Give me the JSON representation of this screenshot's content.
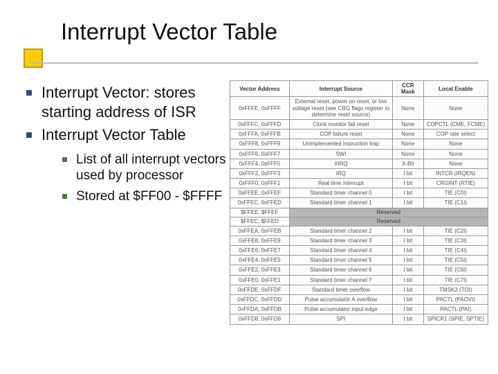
{
  "title": "Interrupt Vector Table",
  "bullets": {
    "b1": "Interrupt Vector: stores starting address of ISR",
    "b2": "Interrupt Vector Table",
    "b2a": "List of all interrupt vectors used by processor",
    "b2b": "Stored at $FF00 - $FFFF"
  },
  "table": {
    "headers": {
      "addr": "Vector Address",
      "src": "Interrupt Source",
      "mask": "CCR Mask",
      "en": "Local Enable"
    },
    "rows": [
      {
        "addr": "0xFFFE, 0xFFFF",
        "src": "External reset, power on reset, or low voltage reset (see CRG flags register to determine reset source)",
        "mask": "None",
        "en": "None"
      },
      {
        "addr": "0xFFFC, 0xFFFD",
        "src": "Clock monitor fail reset",
        "mask": "None",
        "en": "COPCTL (CME, FCME)"
      },
      {
        "addr": "0xFFFA, 0xFFFB",
        "src": "COP failure reset",
        "mask": "None",
        "en": "COP rate select"
      },
      {
        "addr": "0xFFF8, 0xFFF9",
        "src": "Unimplemented instruction trap",
        "mask": "None",
        "en": "None"
      },
      {
        "addr": "0xFFF6, 0xFFF7",
        "src": "SWI",
        "mask": "None",
        "en": "None"
      },
      {
        "addr": "0xFFF4, 0xFFF5",
        "src": "XIRQ",
        "mask": "X-Bit",
        "en": "None"
      },
      {
        "addr": "0xFFF2, 0xFFF3",
        "src": "IRQ",
        "mask": "I bit",
        "en": "INTCR (IRQEN)"
      },
      {
        "addr": "0xFFF0, 0xFFF1",
        "src": "Real time Interrupt",
        "mask": "I bit",
        "en": "CRGINT (RTIE)"
      },
      {
        "addr": "0xFFEE, 0xFFEF",
        "src": "Standard timer channel 0",
        "mask": "I bit",
        "en": "TIE (C0I)"
      },
      {
        "addr": "0xFFEC, 0xFFED",
        "src": "Standard timer channel 1",
        "mask": "I bit",
        "en": "TIE (C1I)"
      },
      {
        "addr": "$FFEE, $FFEF",
        "reserved": true
      },
      {
        "addr": "$FFEC, $FFED",
        "reserved": true
      },
      {
        "addr": "0xFFEA, 0xFFEB",
        "src": "Standard timer channel 2",
        "mask": "I bit",
        "en": "TIE (C2I)"
      },
      {
        "addr": "0xFFE8, 0xFFE9",
        "src": "Standard timer channel 3",
        "mask": "I bit",
        "en": "TIE (C3I)"
      },
      {
        "addr": "0xFFE6, 0xFFE7",
        "src": "Standard timer channel 4",
        "mask": "I bit",
        "en": "TIE (C4I)"
      },
      {
        "addr": "0xFFE4, 0xFFE5",
        "src": "Standard timer channel 5",
        "mask": "I bit",
        "en": "TIE (C5I)"
      },
      {
        "addr": "0xFFE2, 0xFFE3",
        "src": "Standard timer channel 6",
        "mask": "I bit",
        "en": "TIE (C6I)"
      },
      {
        "addr": "0xFFE0, 0xFFE1",
        "src": "Standard timer channel 7",
        "mask": "I bit",
        "en": "TIE (C7I)"
      },
      {
        "addr": "0xFFDE, 0xFFDF",
        "src": "Standard timer overflow",
        "mask": "I bit",
        "en": "TMSK2 (TOI)"
      },
      {
        "addr": "0xFFDC, 0xFFDD",
        "src": "Pulse accumulator A overflow",
        "mask": "I bit",
        "en": "PACTL (PAOVI)"
      },
      {
        "addr": "0xFFDA, 0xFFDB",
        "src": "Pulse accumulator input edge",
        "mask": "I bit",
        "en": "PACTL (PAI)"
      },
      {
        "addr": "0xFFD8, 0xFFD9",
        "src": "SPI",
        "mask": "I bit",
        "en": "SPICR1 (SPIE, SPTIE)"
      }
    ],
    "reserved_label": "Reserved"
  }
}
